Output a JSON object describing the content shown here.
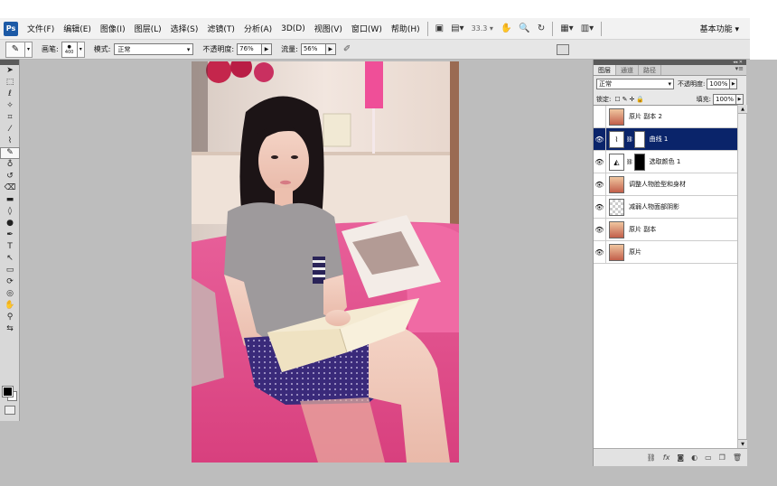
{
  "menubar": {
    "logo": "Ps",
    "items": [
      "文件(F)",
      "编辑(E)",
      "图像(I)",
      "图层(L)",
      "选择(S)",
      "滤镜(T)",
      "分析(A)",
      "3D(D)",
      "视图(V)",
      "窗口(W)",
      "帮助(H)"
    ],
    "zoom": "33.3",
    "workspace": "基本功能 ▾"
  },
  "options": {
    "brush_label": "画笔:",
    "brush_size": "400",
    "mode_label": "模式:",
    "mode_value": "正常",
    "opacity_label": "不透明度:",
    "opacity_value": "76%",
    "flow_label": "流量:",
    "flow_value": "56%"
  },
  "panel": {
    "tabs": [
      "图层",
      "通道",
      "路径"
    ],
    "blend_mode": "正常",
    "opacity_label": "不透明度:",
    "opacity_value": "100%",
    "lock_label": "锁定:",
    "fill_label": "填充:",
    "fill_value": "100%",
    "layers": [
      {
        "name": "原片 副本 2",
        "visible": false,
        "type": "photo",
        "selected": false
      },
      {
        "name": "曲线 1",
        "visible": true,
        "type": "curves",
        "selected": true
      },
      {
        "name": "选取颜色 1",
        "visible": true,
        "type": "selective",
        "selected": false
      },
      {
        "name": "调整人物脸型和身材",
        "visible": true,
        "type": "photo",
        "selected": false
      },
      {
        "name": "减弱人物面部阴影",
        "visible": true,
        "type": "transparent",
        "selected": false
      },
      {
        "name": "原片 副本",
        "visible": true,
        "type": "photo",
        "selected": false
      },
      {
        "name": "原片",
        "visible": true,
        "type": "photo",
        "selected": false
      }
    ]
  },
  "colors": {
    "selected_layer": "#0a246a",
    "foreground": "#000000",
    "background": "#ffffff"
  }
}
